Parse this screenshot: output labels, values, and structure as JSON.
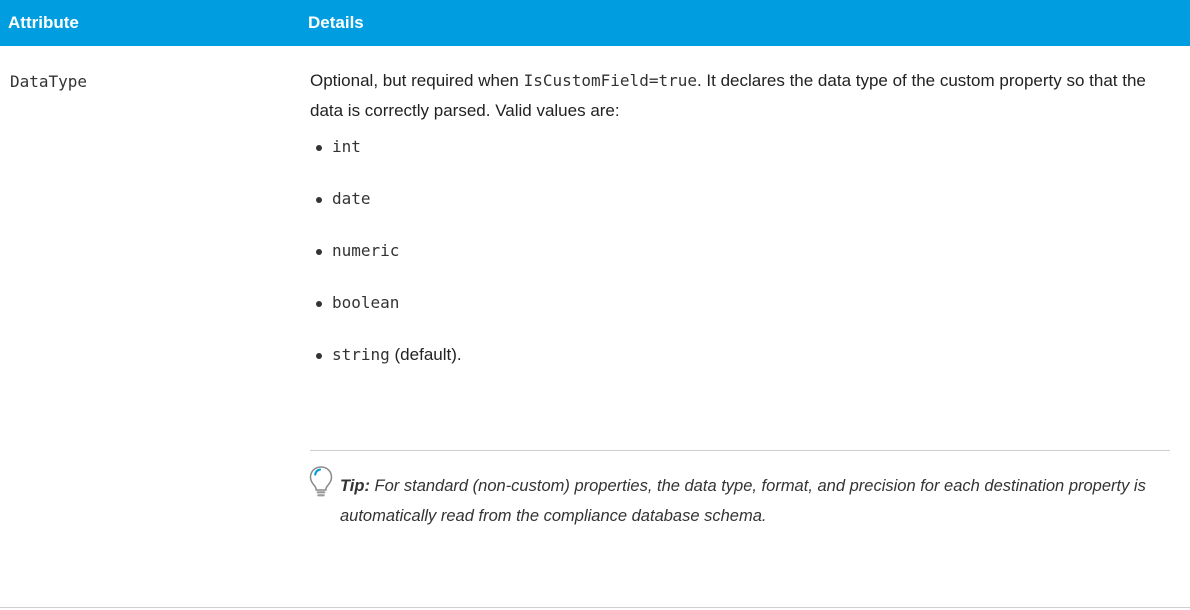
{
  "table": {
    "headers": {
      "attribute": "Attribute",
      "details": "Details"
    },
    "row": {
      "attribute": "DataType",
      "intro_text_1": "Optional, but required when ",
      "intro_code": "IsCustomField=true",
      "intro_text_2": ". It declares the data type of the custom property so that the data is correctly parsed. Valid values are:",
      "values": [
        {
          "code": "int",
          "suffix": ""
        },
        {
          "code": "date",
          "suffix": ""
        },
        {
          "code": "numeric",
          "suffix": ""
        },
        {
          "code": "boolean",
          "suffix": ""
        },
        {
          "code": "string",
          "suffix": " (default)."
        }
      ],
      "tip": {
        "icon": "lightbulb-icon",
        "label": "Tip:",
        "text": " For standard (non-custom) properties, the data type, format, and precision for each destination property is automatically read from the compliance database schema."
      }
    }
  },
  "colors": {
    "header_background": "#009ee0",
    "header_text": "#ffffff",
    "rule": "#cfcfcf"
  }
}
